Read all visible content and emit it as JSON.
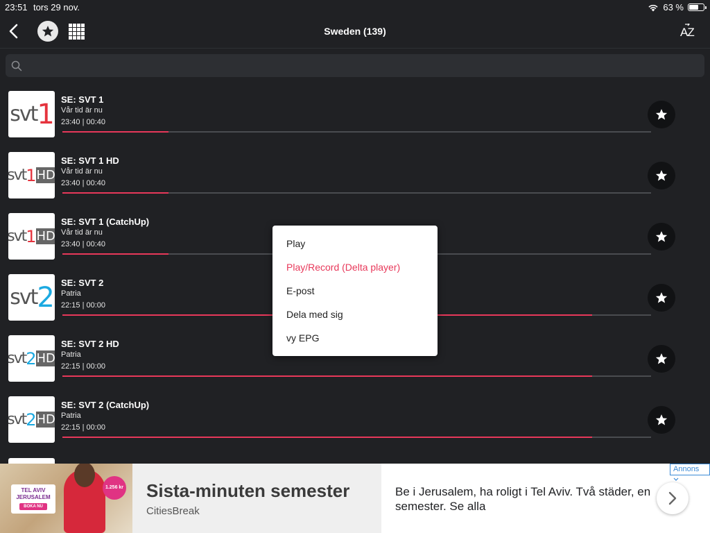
{
  "statusbar": {
    "time": "23:51",
    "date": "tors 29 nov.",
    "battery": "63 %",
    "battery_level": 0.63
  },
  "navbar": {
    "title": "Sweden (139)",
    "sort_label": "AZ",
    "back_icon": "chevron-left-icon",
    "favorites_icon": "star-icon",
    "grid_icon": "grid-icon"
  },
  "search": {
    "placeholder": "",
    "value": ""
  },
  "channels": [
    {
      "name": "SE: SVT 1",
      "program": "Vår tid är nu",
      "time": "23:40 | 00:40",
      "logo_text": "svt",
      "logo_num": "1",
      "logo_hd": "",
      "progress": 0.18
    },
    {
      "name": "SE: SVT 1 HD",
      "program": "Vår tid är nu",
      "time": "23:40 | 00:40",
      "logo_text": "svt",
      "logo_num": "1",
      "logo_hd": "HD",
      "progress": 0.18
    },
    {
      "name": "SE: SVT 1 (CatchUp)",
      "program": "Vår tid är nu",
      "time": "23:40 | 00:40",
      "logo_text": "svt",
      "logo_num": "1",
      "logo_hd": "HD",
      "progress": 0.18
    },
    {
      "name": "SE: SVT 2",
      "program": "Patria",
      "time": "22:15 | 00:00",
      "logo_text": "svt",
      "logo_num": "2",
      "logo_hd": "",
      "progress": 0.9
    },
    {
      "name": "SE: SVT 2 HD",
      "program": "Patria",
      "time": "22:15 | 00:00",
      "logo_text": "svt",
      "logo_num": "2",
      "logo_hd": "HD",
      "progress": 0.9
    },
    {
      "name": "SE: SVT 2 (CatchUp)",
      "program": "Patria",
      "time": "22:15 | 00:00",
      "logo_text": "svt",
      "logo_num": "2",
      "logo_hd": "HD",
      "progress": 0.9
    }
  ],
  "context_menu": {
    "items": [
      "Play",
      "Play/Record (Delta player)",
      "E-post",
      "Dela med sig",
      "vy EPG"
    ]
  },
  "colors": {
    "accent": "#e8385a",
    "svt1_red": "#e5333d",
    "svt2_blue": "#1ba9e1",
    "background": "#202124"
  },
  "ad": {
    "headline": "Sista-minuten semester",
    "source": "CitiesBreak",
    "description": "Be i Jerusalem, ha roligt i Tel Aviv. Två städer, en semester. Se alla",
    "label": "Annons",
    "image_sign": "TEL AVIV JERUSALEM",
    "image_cta": "BOKA NU",
    "image_price": "1.256 kr"
  }
}
